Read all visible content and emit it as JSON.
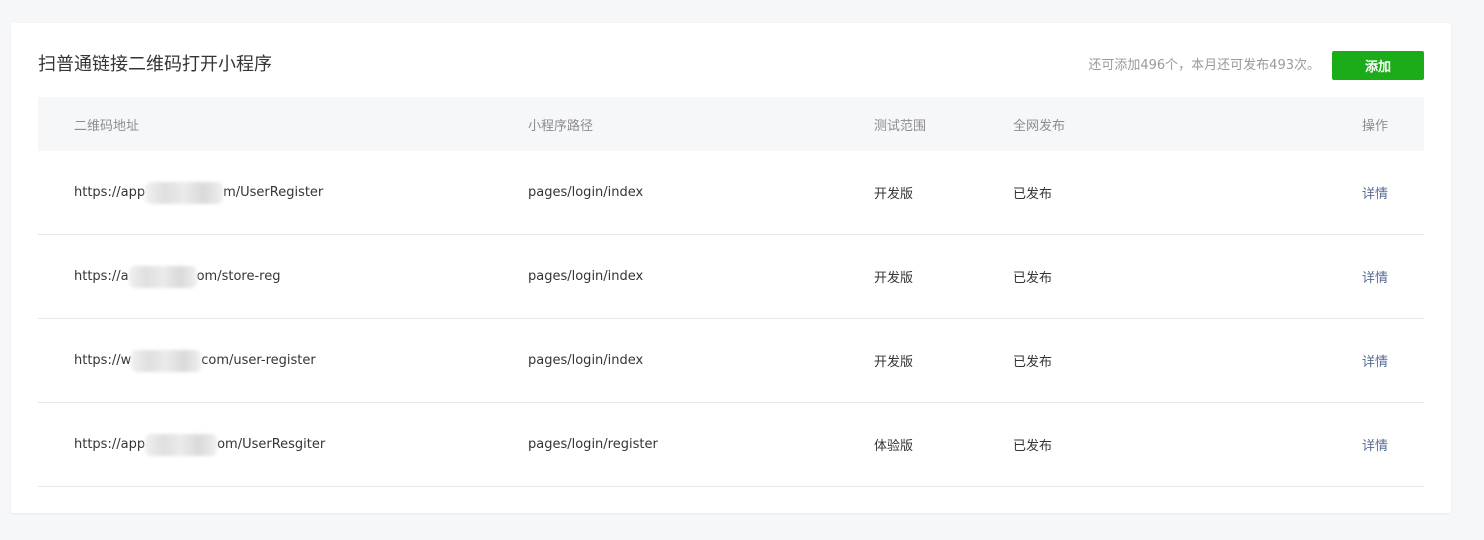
{
  "header": {
    "title": "扫普通链接二维码打开小程序",
    "quota_text": "还可添加496个，本月还可发布493次。",
    "add_label": "添加"
  },
  "colors": {
    "accent": "#1aad19",
    "link": "#576b95",
    "muted": "#9a9a9a"
  },
  "table": {
    "headers": {
      "url": "二维码地址",
      "path": "小程序路径",
      "test_scope": "测试范围",
      "publish": "全网发布",
      "actions": "操作"
    },
    "rows": [
      {
        "url_prefix": "https://app",
        "url_suffix": "m/UserRegister",
        "path": "pages/login/index",
        "test_scope": "开发版",
        "publish": "已发布",
        "action": "详情"
      },
      {
        "url_prefix": "https://a",
        "url_suffix": "om/store-reg",
        "path": "pages/login/index",
        "test_scope": "开发版",
        "publish": "已发布",
        "action": "详情"
      },
      {
        "url_prefix": "https://w",
        "url_suffix": "com/user-register",
        "path": "pages/login/index",
        "test_scope": "开发版",
        "publish": "已发布",
        "action": "详情"
      },
      {
        "url_prefix": "https://app",
        "url_suffix": "om/UserResgiter",
        "path": "pages/login/register",
        "test_scope": "体验版",
        "publish": "已发布",
        "action": "详情"
      }
    ]
  }
}
